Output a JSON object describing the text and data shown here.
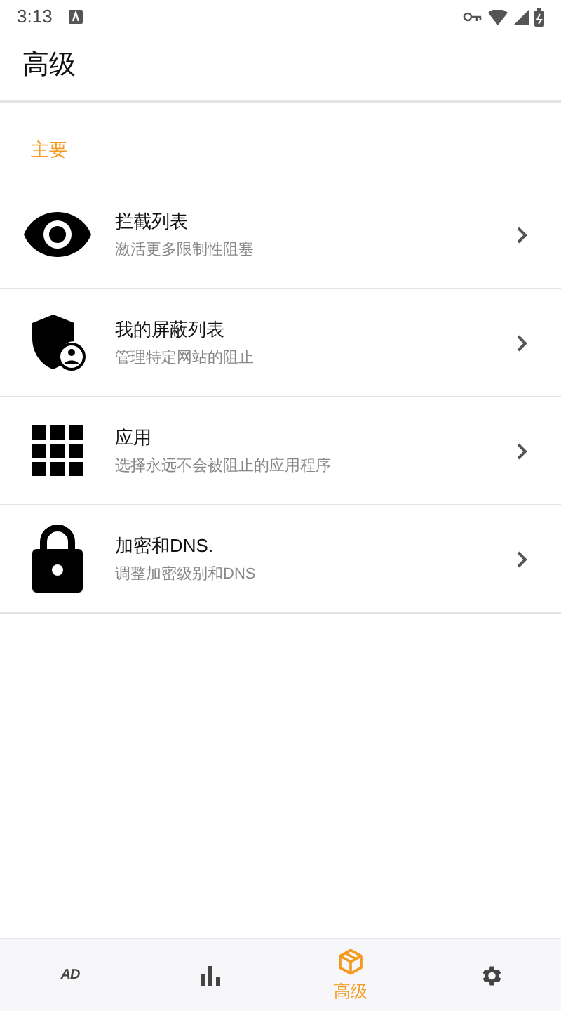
{
  "status_bar": {
    "time": "3:13"
  },
  "app_bar": {
    "title": "高级"
  },
  "section": {
    "title": "主要"
  },
  "items": [
    {
      "kind": "eye",
      "title": "拦截列表",
      "subtitle": "激活更多限制性阻塞"
    },
    {
      "kind": "shield",
      "title": "我的屏蔽列表",
      "subtitle": "管理特定网站的阻止"
    },
    {
      "kind": "grid",
      "title": "应用",
      "subtitle": "选择永远不会被阻止的应用程序"
    },
    {
      "kind": "lock",
      "title": "加密和DNS.",
      "subtitle": "调整加密级别和DNS"
    }
  ],
  "bottom_nav": [
    {
      "kind": "logo",
      "text": "AD",
      "selected": false
    },
    {
      "kind": "stats",
      "selected": false
    },
    {
      "kind": "box",
      "label": "高级",
      "selected": true
    },
    {
      "kind": "gear",
      "selected": false
    }
  ]
}
